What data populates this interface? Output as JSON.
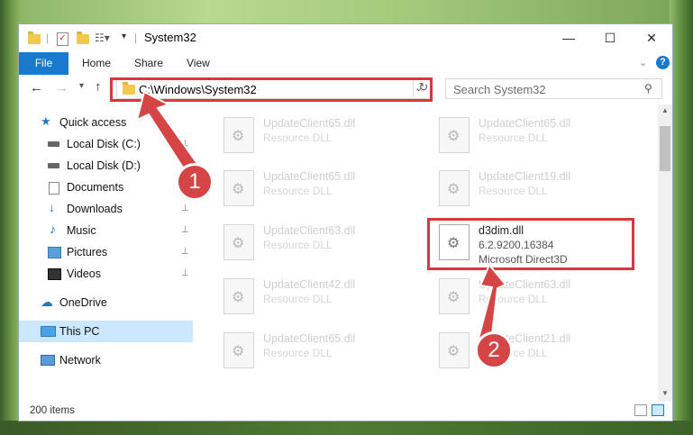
{
  "window": {
    "title": "System32",
    "controls": {
      "minimize": "—",
      "maximize": "☐",
      "close": "✕"
    }
  },
  "ribbon": {
    "file": "File",
    "tabs": [
      "Home",
      "Share",
      "View"
    ]
  },
  "navbar": {
    "address": "C:\\Windows\\System32",
    "search_placeholder": "Search System32"
  },
  "sidebar": {
    "items": [
      {
        "label": "Quick access",
        "icon": "star-icon"
      },
      {
        "label": "Local Disk (C:)",
        "icon": "drive-icon"
      },
      {
        "label": "Local Disk (D:)",
        "icon": "drive-icon"
      },
      {
        "label": "Documents",
        "icon": "documents-icon"
      },
      {
        "label": "Downloads",
        "icon": "download-icon"
      },
      {
        "label": "Music",
        "icon": "music-icon"
      },
      {
        "label": "Pictures",
        "icon": "pictures-icon"
      },
      {
        "label": "Videos",
        "icon": "videos-icon"
      },
      {
        "label": "OneDrive",
        "icon": "cloud-icon"
      },
      {
        "label": "This PC",
        "icon": "computer-icon"
      },
      {
        "label": "Network",
        "icon": "network-icon"
      }
    ]
  },
  "files": {
    "faded": [
      {
        "name": "UpdateClient65.dll",
        "type": "Resource DLL"
      },
      {
        "name": "UpdateClient65.dll",
        "type": "Resource DLL"
      },
      {
        "name": "UpdateClient65.dll",
        "type": "Resource DLL"
      },
      {
        "name": "UpdateClient19.dll",
        "type": "Resource DLL"
      },
      {
        "name": "UpdateClient63.dll",
        "type": "Resource DLL"
      },
      {
        "name": "UpdateClient42.dll",
        "type": "Resource DLL"
      },
      {
        "name": "UpdateClient63.dll",
        "type": "Resource DLL"
      },
      {
        "name": "UpdateClient65.dll",
        "type": "Resource DLL"
      },
      {
        "name": "UpdateClient21.dll",
        "type": "Resource DLL"
      }
    ],
    "highlighted": {
      "name": "d3dim.dll",
      "version": "6.2.9200.16384",
      "description": "Microsoft Direct3D"
    }
  },
  "status": {
    "items": "200 items"
  },
  "annotations": {
    "step1": "1",
    "step2": "2"
  },
  "colors": {
    "accent": "#1979ca",
    "annotation": "#d9363e"
  }
}
